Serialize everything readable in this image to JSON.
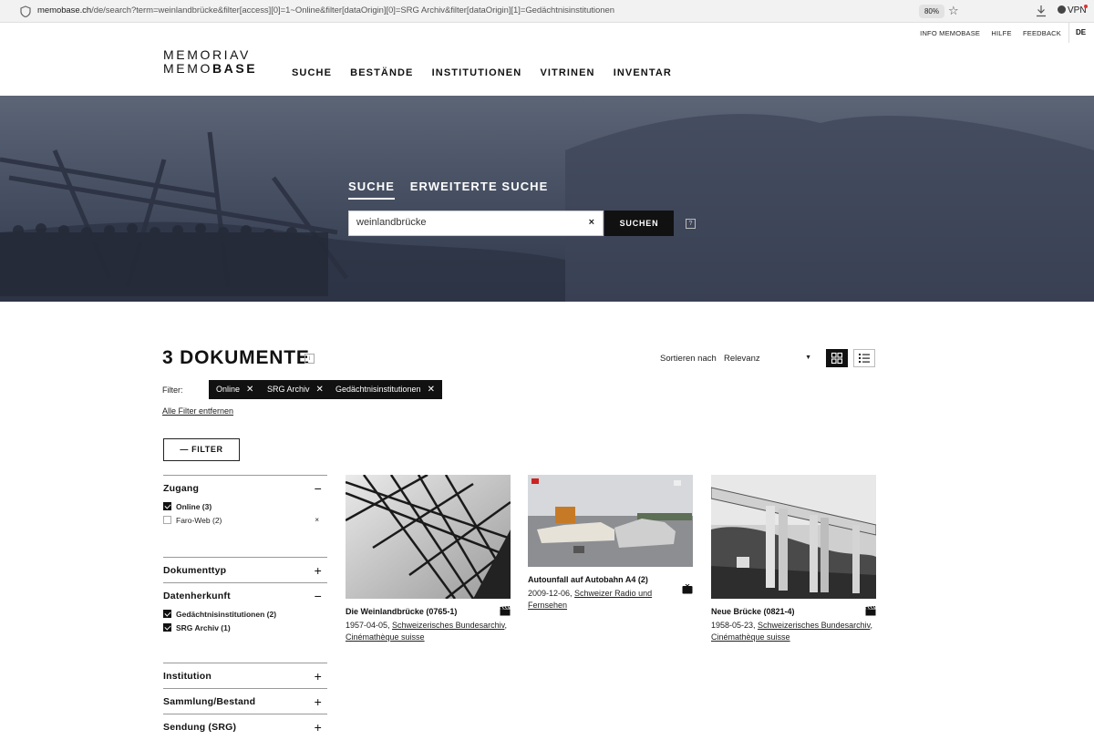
{
  "browser": {
    "url_host": "memobase.ch",
    "url_path": "/de/search?term=weinlandbrücke&filter[access][0]=1~Online&filter[dataOrigin][0]=SRG Archiv&filter[dataOrigin][1]=Gedächtnisinstitutionen",
    "zoom": "80%",
    "vpn_label": "VPN"
  },
  "header": {
    "utility_links": [
      "INFO MEMOBASE",
      "HILFE",
      "FEEDBACK"
    ],
    "language": "DE",
    "logo_line1": "MEMORIAV",
    "logo_line2_a": "MEMO",
    "logo_line2_b": "BASE",
    "nav": [
      "SUCHE",
      "BESTÄNDE",
      "INSTITUTIONEN",
      "VITRINEN",
      "INVENTAR"
    ]
  },
  "search": {
    "tabs": [
      "SUCHE",
      "ERWEITERTE SUCHE"
    ],
    "query": "weinlandbrücke",
    "clear_icon": "×",
    "button": "SUCHEN",
    "help_icon": "?"
  },
  "results": {
    "title": "3 DOKUMENTE",
    "info_icon": "i",
    "sort_label": "Sortieren nach",
    "sort_value": "Relevanz",
    "filter_label": "Filter:",
    "chips": [
      "Online",
      "SRG Archiv",
      "Gedächtnisinstitutionen"
    ],
    "chip_close": "✕",
    "remove_all": "Alle Filter entfernen",
    "filter_button": "FILTER"
  },
  "facets": {
    "zugang": {
      "title": "Zugang",
      "toggle": "−",
      "options": [
        {
          "label": "Online (3)",
          "checked": true
        },
        {
          "label": "Faro-Web (2)",
          "checked": false,
          "remove": "×"
        }
      ]
    },
    "dokumenttyp": {
      "title": "Dokumenttyp",
      "toggle": "+"
    },
    "datenherkunft": {
      "title": "Datenherkunft",
      "toggle": "−",
      "options": [
        {
          "label": "Gedächtnisinstitutionen (2)",
          "checked": true
        },
        {
          "label": "SRG Archiv (1)",
          "checked": true
        }
      ]
    },
    "institution": {
      "title": "Institution",
      "toggle": "+"
    },
    "sammlung": {
      "title": "Sammlung/Bestand",
      "toggle": "+"
    },
    "sendung": {
      "title": "Sendung (SRG)",
      "toggle": "+"
    }
  },
  "cards": [
    {
      "title": "Die Weinlandbrücke (0765-1)",
      "date": "1957-04-05, ",
      "link1": "Schweizerisches Bundesarchiv",
      "sep": ", ",
      "link2": "Cinémathèque suisse",
      "type_icon": "film-clapper-icon"
    },
    {
      "title": "Autounfall auf Autobahn A4 (2)",
      "date": "2009-12-06, ",
      "link1": "Schweizer Radio und Fernsehen",
      "sep": "",
      "link2": "",
      "type_icon": "tv-icon"
    },
    {
      "title": "Neue Brücke (0821-4)",
      "date": "1958-05-23, ",
      "link1": "Schweizerisches Bundesarchiv",
      "sep": ", ",
      "link2": "Cinémathèque suisse",
      "type_icon": "film-clapper-icon"
    }
  ]
}
